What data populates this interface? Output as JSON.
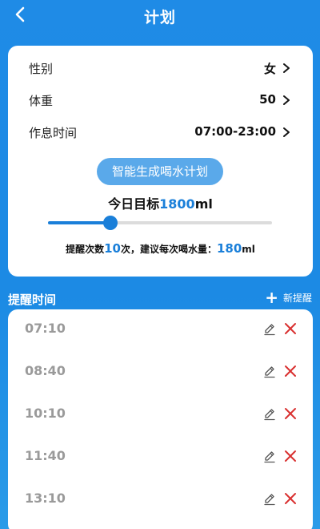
{
  "header": {
    "title": "计划",
    "back_icon": "chevron-left-icon"
  },
  "settings": {
    "rows": [
      {
        "label": "性别",
        "value": "女"
      },
      {
        "label": "体重",
        "value": "50"
      },
      {
        "label": "作息时间",
        "value": "07:00-23:00"
      }
    ],
    "generate_button": "智能生成喝水计划",
    "target": {
      "prefix": "今日目标",
      "amount": "1800",
      "unit": "ml"
    },
    "slider": {
      "fraction": 0.28
    },
    "reminder": {
      "part1": "提醒次数",
      "count": "10",
      "part2": "次，建议每次喝水量：",
      "amount": "180",
      "unit": "ml"
    }
  },
  "reminders": {
    "section_title": "提醒时间",
    "new_label": "新提醒",
    "times": [
      "07:10",
      "08:40",
      "10:10",
      "11:40",
      "13:10"
    ]
  },
  "colors": {
    "accent": "#1a7fd9",
    "background": "#1f8be6",
    "button": "#5aa9ea",
    "delete": "#d9302f"
  }
}
